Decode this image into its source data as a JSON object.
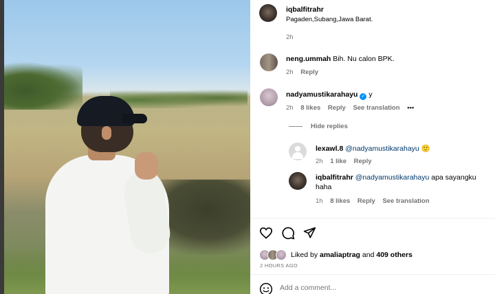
{
  "post": {
    "author": "iqbalfitrahr",
    "location": "Pagaden,Subang,Jawa Barat.",
    "caption_time": "2h"
  },
  "comments": [
    {
      "user": "neng.ummah",
      "text": "Bih. Nu calon BPK.",
      "time": "2h",
      "reply": "Reply"
    },
    {
      "user": "nadyamustikarahayu",
      "text": "y",
      "time": "2h",
      "likes": "8 likes",
      "reply": "Reply",
      "translate": "See translation",
      "more": "•••",
      "hide_replies": "Hide replies"
    }
  ],
  "replies": [
    {
      "user": "lexawl.8",
      "mention": "@nadyamustikarahayu",
      "emoji": "🙂",
      "time": "2h",
      "likes": "1 like",
      "reply": "Reply"
    },
    {
      "user": "iqbalfitrahr",
      "mention": "@nadyamustikarahayu",
      "text_line1": "apa sayangku",
      "text_line2": "haha",
      "time": "1h",
      "likes": "8 likes",
      "reply": "Reply",
      "translate": "See translation"
    }
  ],
  "actions": {
    "like_icon": "heart-icon",
    "comment_icon": "comment-icon",
    "share_icon": "share-icon"
  },
  "likes": {
    "prefix": "Liked by",
    "user": "amaliaptrag",
    "and": "and",
    "others": "409 others",
    "time_ago": "2 HOURS AGO"
  },
  "comment_box": {
    "placeholder": "Add a comment...",
    "emoji_icon": "smiley-icon"
  },
  "colors": {
    "link": "#00376b",
    "verified": "#0095f6",
    "meta": "#737373"
  }
}
